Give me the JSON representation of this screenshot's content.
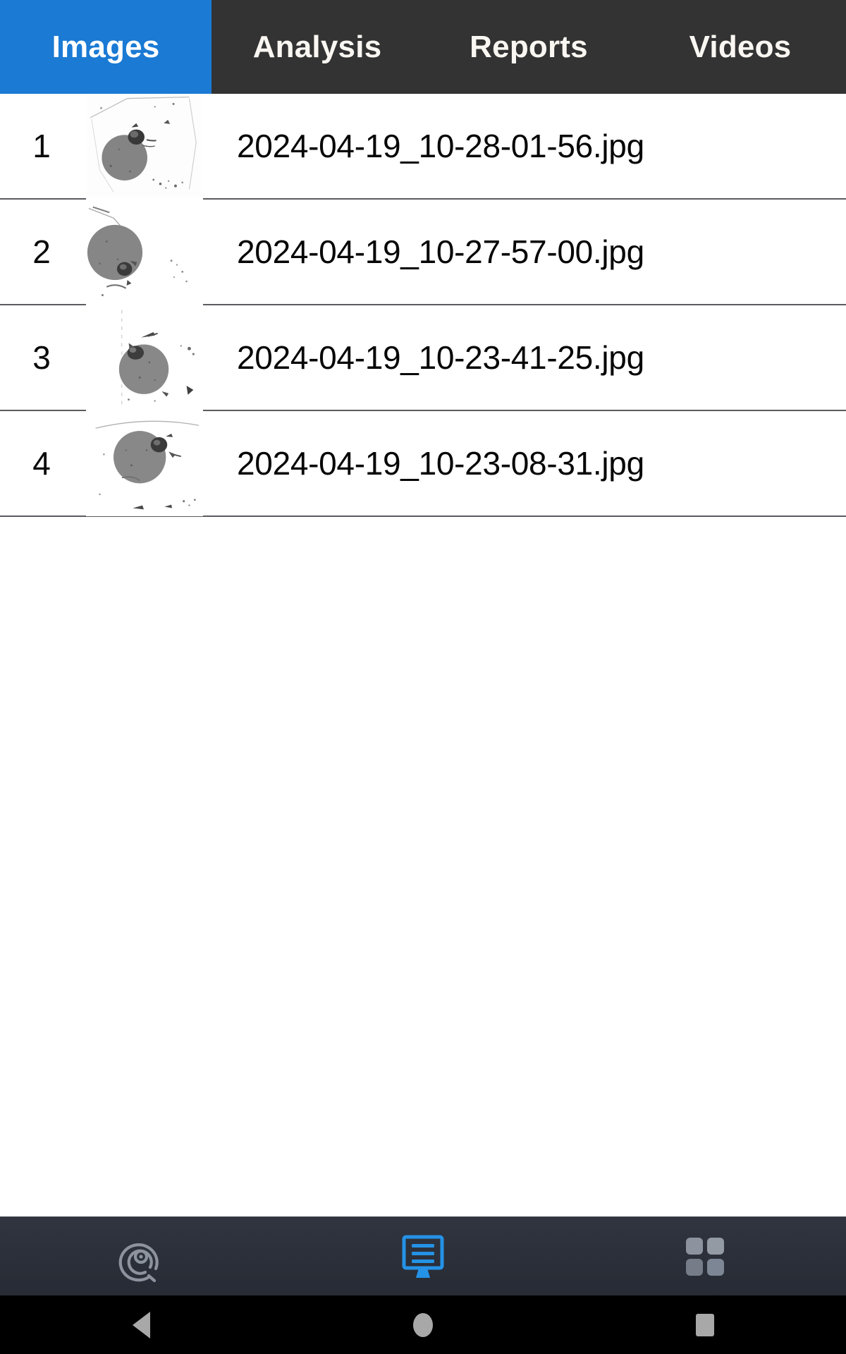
{
  "tabs": [
    {
      "label": "Images",
      "active": true
    },
    {
      "label": "Analysis",
      "active": false
    },
    {
      "label": "Reports",
      "active": false
    },
    {
      "label": "Videos",
      "active": false
    }
  ],
  "colors": {
    "tab_active_bg": "#1a7ad4",
    "tab_bar_bg": "#333333",
    "tab_text": "#faf7f2",
    "row_divider": "#5b5b60",
    "row_text": "#060606",
    "bottom_bar_bg": "#2c303a",
    "bottom_icon_active": "#2492e6",
    "bottom_icon_inactive": "#8d939e",
    "nav_bar_bg": "#000000",
    "nav_icon": "#a8a8a8"
  },
  "list": {
    "rows": [
      {
        "index": "1",
        "filename": "2024-04-19_10-28-01-56.jpg",
        "thumbnail": "grayscale-blob-thumbnail"
      },
      {
        "index": "2",
        "filename": "2024-04-19_10-27-57-00.jpg",
        "thumbnail": "grayscale-blob-thumbnail"
      },
      {
        "index": "3",
        "filename": "2024-04-19_10-23-41-25.jpg",
        "thumbnail": "grayscale-blob-thumbnail"
      },
      {
        "index": "4",
        "filename": "2024-04-19_10-23-08-31.jpg",
        "thumbnail": "grayscale-blob-thumbnail"
      }
    ]
  },
  "bottom_bar": {
    "items": [
      {
        "icon": "spiral-target-icon",
        "active": false
      },
      {
        "icon": "monitor-list-icon",
        "active": true
      },
      {
        "icon": "grid-apps-icon",
        "active": false
      }
    ]
  },
  "nav_bar": {
    "items": [
      {
        "icon": "back-triangle-icon"
      },
      {
        "icon": "home-circle-icon"
      },
      {
        "icon": "recents-square-icon"
      }
    ]
  }
}
